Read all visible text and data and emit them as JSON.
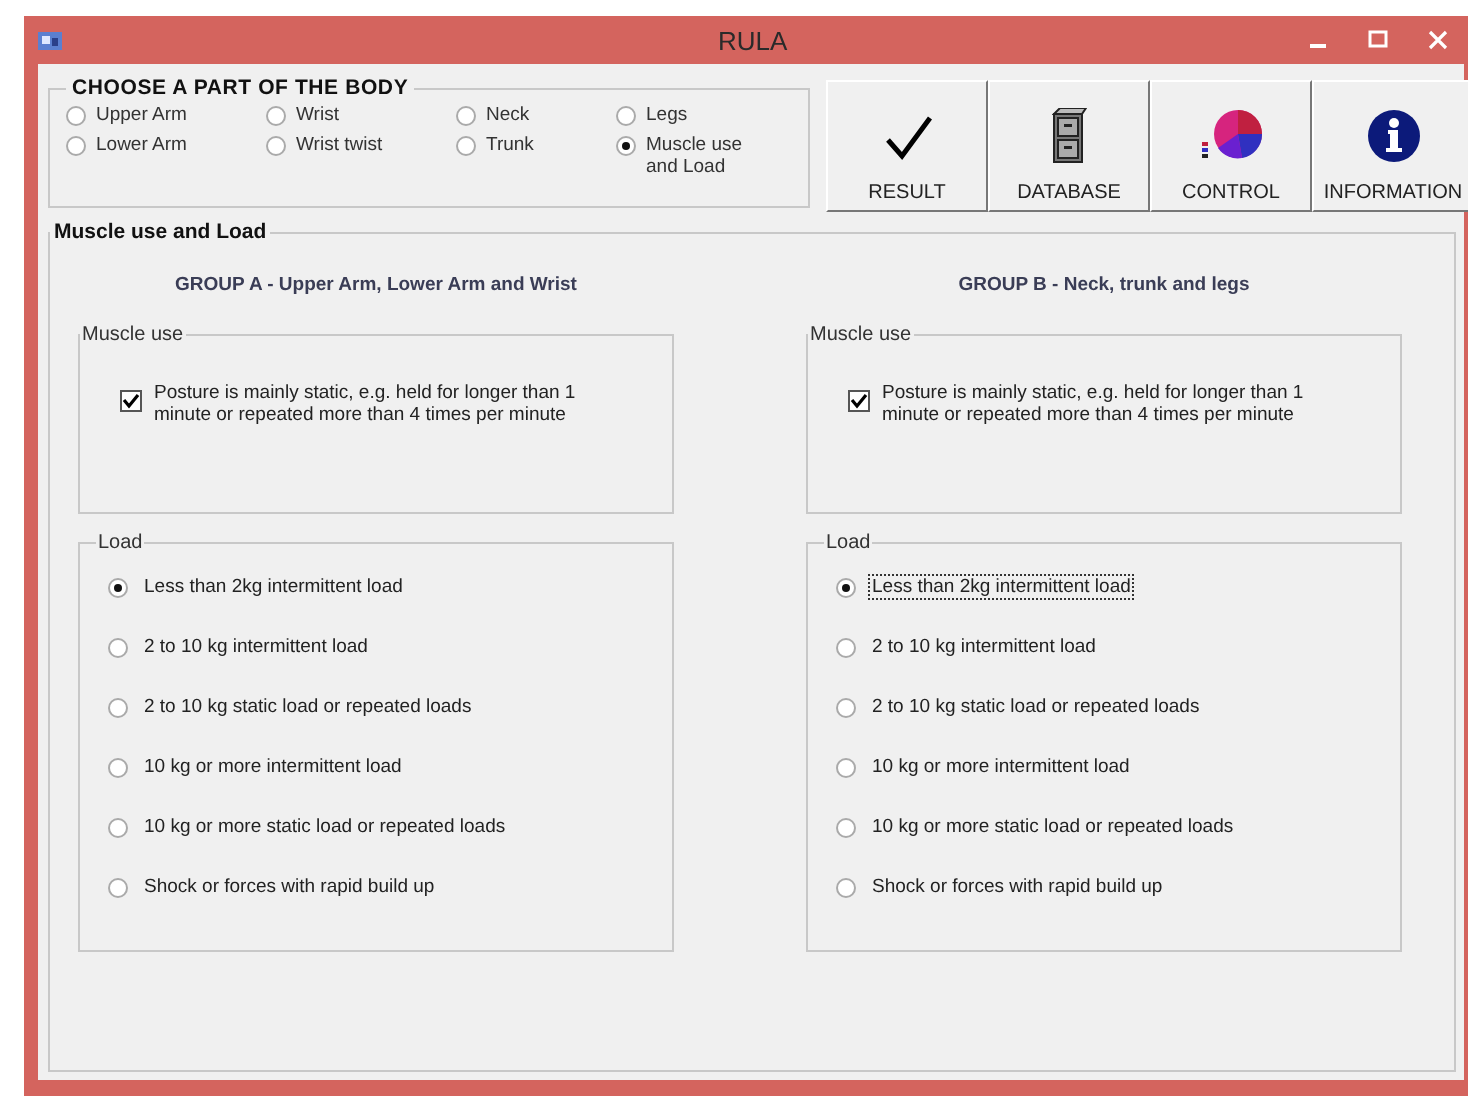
{
  "window": {
    "title": "RULA"
  },
  "body_part": {
    "title": "CHOOSE A PART OF THE BODY",
    "options": [
      {
        "label": "Upper Arm",
        "selected": false
      },
      {
        "label": "Wrist",
        "selected": false
      },
      {
        "label": "Neck",
        "selected": false
      },
      {
        "label": "Legs",
        "selected": false
      },
      {
        "label": "Lower Arm",
        "selected": false
      },
      {
        "label": "Wrist twist",
        "selected": false
      },
      {
        "label": "Trunk",
        "selected": false
      },
      {
        "label": "Muscle use and Load",
        "selected": true
      }
    ]
  },
  "toolbar": [
    {
      "label": "RESULT",
      "kind": "check"
    },
    {
      "label": "DATABASE",
      "kind": "cabinet"
    },
    {
      "label": "CONTROL",
      "kind": "chart"
    },
    {
      "label": "INFORMATION",
      "kind": "info"
    }
  ],
  "section": {
    "title": "Muscle use and Load",
    "groups": [
      {
        "heading": "GROUP A - Upper Arm, Lower Arm and Wrist",
        "muscle_use": {
          "title": "Muscle use",
          "label": "Posture is mainly static, e.g. held for longer than 1 minute or repeated more than 4 times per minute",
          "checked": true
        },
        "load": {
          "title": "Load",
          "options": [
            {
              "label": "Less than 2kg intermittent load",
              "selected": true,
              "focused": false
            },
            {
              "label": "2 to 10 kg intermittent load",
              "selected": false,
              "focused": false
            },
            {
              "label": "2 to 10 kg static load or repeated loads",
              "selected": false,
              "focused": false
            },
            {
              "label": "10 kg or more intermittent load",
              "selected": false,
              "focused": false
            },
            {
              "label": "10 kg or more static load or repeated loads",
              "selected": false,
              "focused": false
            },
            {
              "label": "Shock or forces with rapid build up",
              "selected": false,
              "focused": false
            }
          ]
        }
      },
      {
        "heading": "GROUP B - Neck, trunk and legs",
        "muscle_use": {
          "title": "Muscle use",
          "label": "Posture is mainly static, e.g. held for longer than 1 minute or repeated more than 4 times per minute",
          "checked": true
        },
        "load": {
          "title": "Load",
          "options": [
            {
              "label": "Less than 2kg intermittent load",
              "selected": true,
              "focused": true
            },
            {
              "label": "2 to 10 kg intermittent load",
              "selected": false,
              "focused": false
            },
            {
              "label": "2 to 10 kg static load or repeated loads",
              "selected": false,
              "focused": false
            },
            {
              "label": "10 kg or more intermittent load",
              "selected": false,
              "focused": false
            },
            {
              "label": "10 kg or more static load or repeated loads",
              "selected": false,
              "focused": false
            },
            {
              "label": "Shock or forces with rapid build up",
              "selected": false,
              "focused": false
            }
          ]
        }
      }
    ]
  }
}
